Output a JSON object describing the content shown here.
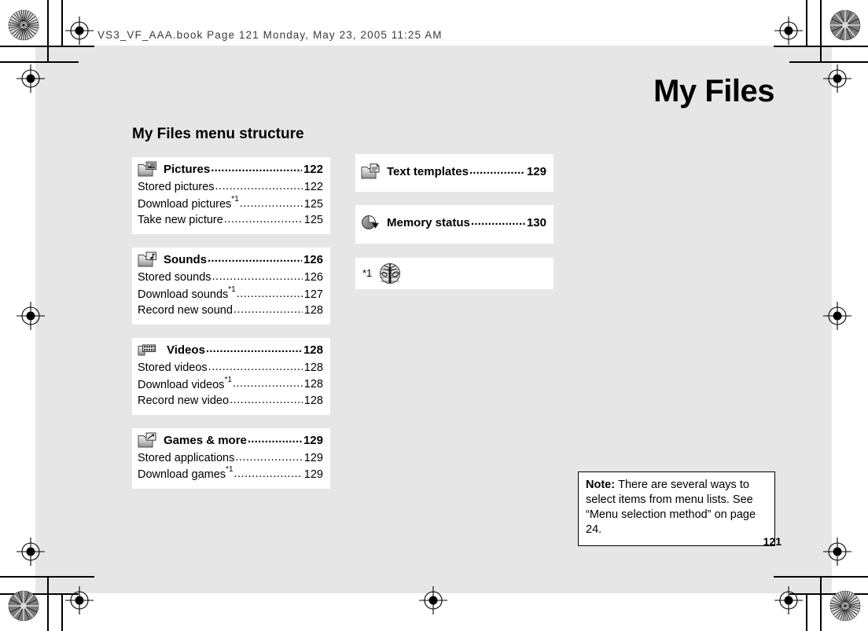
{
  "print_slug": "VS3_VF_AAA.book  Page 121  Monday,  May 23,  2005  11:25 AM",
  "chapter_title": "My Files",
  "section_title": "My Files menu structure",
  "page_number": "121",
  "footnote": {
    "mark": "*1",
    "icon": "network-antenna-icon"
  },
  "note": {
    "label": "Note:",
    "text": "There are several ways to select items from menu lists. See “Menu selection method” on page 24."
  },
  "columns": {
    "left": [
      {
        "icon": "folder-pictures-icon",
        "head": {
          "label": "Pictures",
          "page": "122"
        },
        "items": [
          {
            "label": "Stored pictures",
            "sup": "",
            "page": "122"
          },
          {
            "label": "Download pictures",
            "sup": "*1",
            "page": "125"
          },
          {
            "label": "Take new picture",
            "sup": "",
            "page": "125"
          }
        ]
      },
      {
        "icon": "folder-sounds-icon",
        "head": {
          "label": "Sounds",
          "page": "126"
        },
        "items": [
          {
            "label": "Stored sounds",
            "sup": "",
            "page": "126"
          },
          {
            "label": "Download sounds",
            "sup": "*1",
            "page": "127"
          },
          {
            "label": "Record new sound",
            "sup": "",
            "page": "128"
          }
        ]
      },
      {
        "icon": "folder-videos-icon",
        "head": {
          "label": "Videos",
          "page": "128"
        },
        "items": [
          {
            "label": "Stored videos",
            "sup": "",
            "page": "128"
          },
          {
            "label": "Download videos",
            "sup": "*1",
            "page": "128"
          },
          {
            "label": "Record new video",
            "sup": "",
            "page": "128"
          }
        ]
      },
      {
        "icon": "folder-games-icon",
        "head": {
          "label": "Games & more",
          "page": "129"
        },
        "items": [
          {
            "label": "Stored applications",
            "sup": "",
            "page": "129"
          },
          {
            "label": "Download games",
            "sup": "*1",
            "page": "129"
          }
        ]
      }
    ],
    "right": [
      {
        "icon": "folder-text-templates-icon",
        "head": {
          "label": "Text templates",
          "page": "129"
        },
        "items": []
      },
      {
        "icon": "memory-status-icon",
        "head": {
          "label": "Memory status",
          "page": "130"
        },
        "items": []
      }
    ]
  },
  "colors": {
    "plate_background": "#e6e6e6",
    "card_background": "#ffffff",
    "text": "#000000",
    "slug_text": "#3a3a3a"
  }
}
